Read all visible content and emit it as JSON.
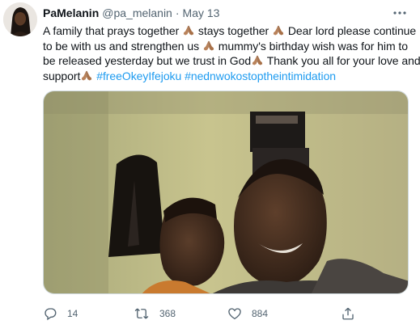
{
  "tweet": {
    "author_name": "PaMelanin",
    "handle": "@pa_melanin",
    "separator": "·",
    "date": "May 13",
    "text": {
      "line1_a": "A family that prays together ",
      "line1_b": " stays together ",
      "line1_c": " Dear lord please continue",
      "line2_a": "to be with us and strengthen us ",
      "line2_b": " mummy's birthday wish was for him to",
      "line3_a": "be released yesterday but we trust in God",
      "line3_b": " Thank you all for your love and",
      "line4_a": "support",
      "hashtag1": "#freeOkeyIfejoku",
      "hashtag2": "#nednwokostoptheintimidation"
    },
    "emoji": "folded-hands",
    "actions": {
      "replies": "14",
      "retweets": "368",
      "likes": "884"
    }
  },
  "colors": {
    "text": "#0f1419",
    "secondary": "#536471",
    "link": "#1d9bf0",
    "border": "#cfd9de"
  },
  "icons": [
    "more-icon",
    "reply-icon",
    "retweet-icon",
    "like-icon",
    "share-icon",
    "folded-hands-emoji"
  ]
}
